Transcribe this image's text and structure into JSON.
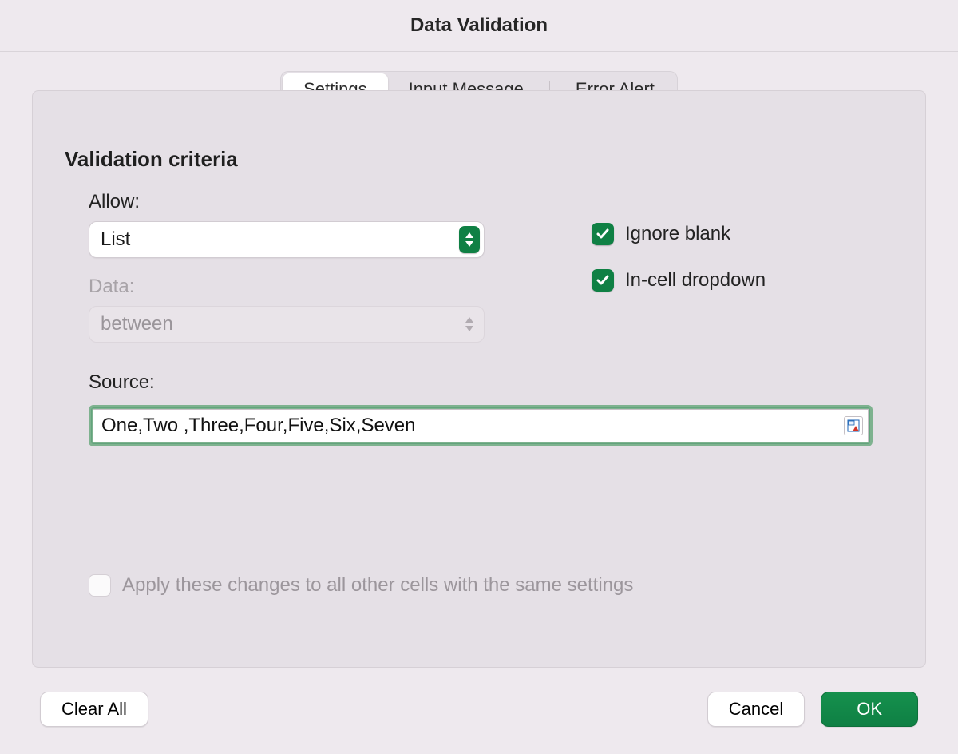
{
  "title": "Data Validation",
  "tabs": {
    "settings": "Settings",
    "input_message": "Input Message",
    "error_alert": "Error Alert"
  },
  "section_title": "Validation criteria",
  "labels": {
    "allow": "Allow:",
    "data": "Data:",
    "source": "Source:"
  },
  "selects": {
    "allow_value": "List",
    "data_value": "between"
  },
  "checkboxes": {
    "ignore_blank": "Ignore blank",
    "in_cell_dropdown": "In-cell dropdown",
    "apply_all": "Apply these changes to all other cells with the same settings"
  },
  "source_value": "One,Two ,Three,Four,Five,Six,Seven",
  "buttons": {
    "clear_all": "Clear All",
    "cancel": "Cancel",
    "ok": "OK"
  }
}
